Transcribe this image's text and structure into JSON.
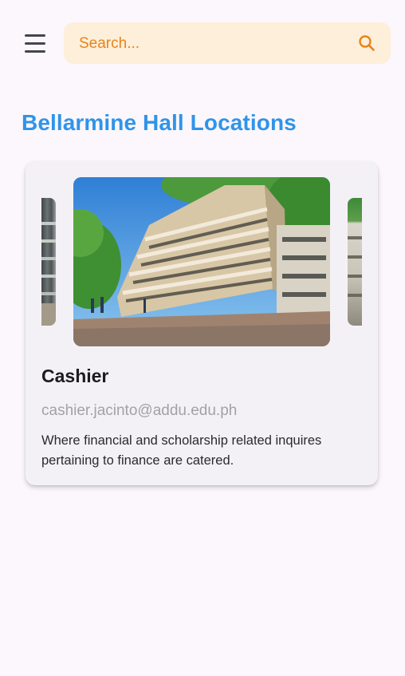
{
  "header": {
    "menu_icon": "hamburger-menu-icon",
    "search": {
      "placeholder": "Search...",
      "value": "",
      "icon": "search-icon"
    }
  },
  "page": {
    "title": "Bellarmine Hall Locations"
  },
  "colors": {
    "background": "#fcf7fc",
    "accent_title": "#2f94ea",
    "search_background": "#fdefd9",
    "search_accent": "#e8831c",
    "card_background": "#f4f1f6"
  },
  "location_card": {
    "name": "Cashier",
    "email": "cashier.jacinto@addu.edu.ph",
    "description": "Where financial and scholarship related inquires pertaining to finance are catered.",
    "carousel": {
      "slides": [
        {
          "kind": "partial-previous"
        },
        {
          "kind": "current",
          "subject": "building-photo"
        },
        {
          "kind": "partial-next"
        }
      ]
    }
  }
}
